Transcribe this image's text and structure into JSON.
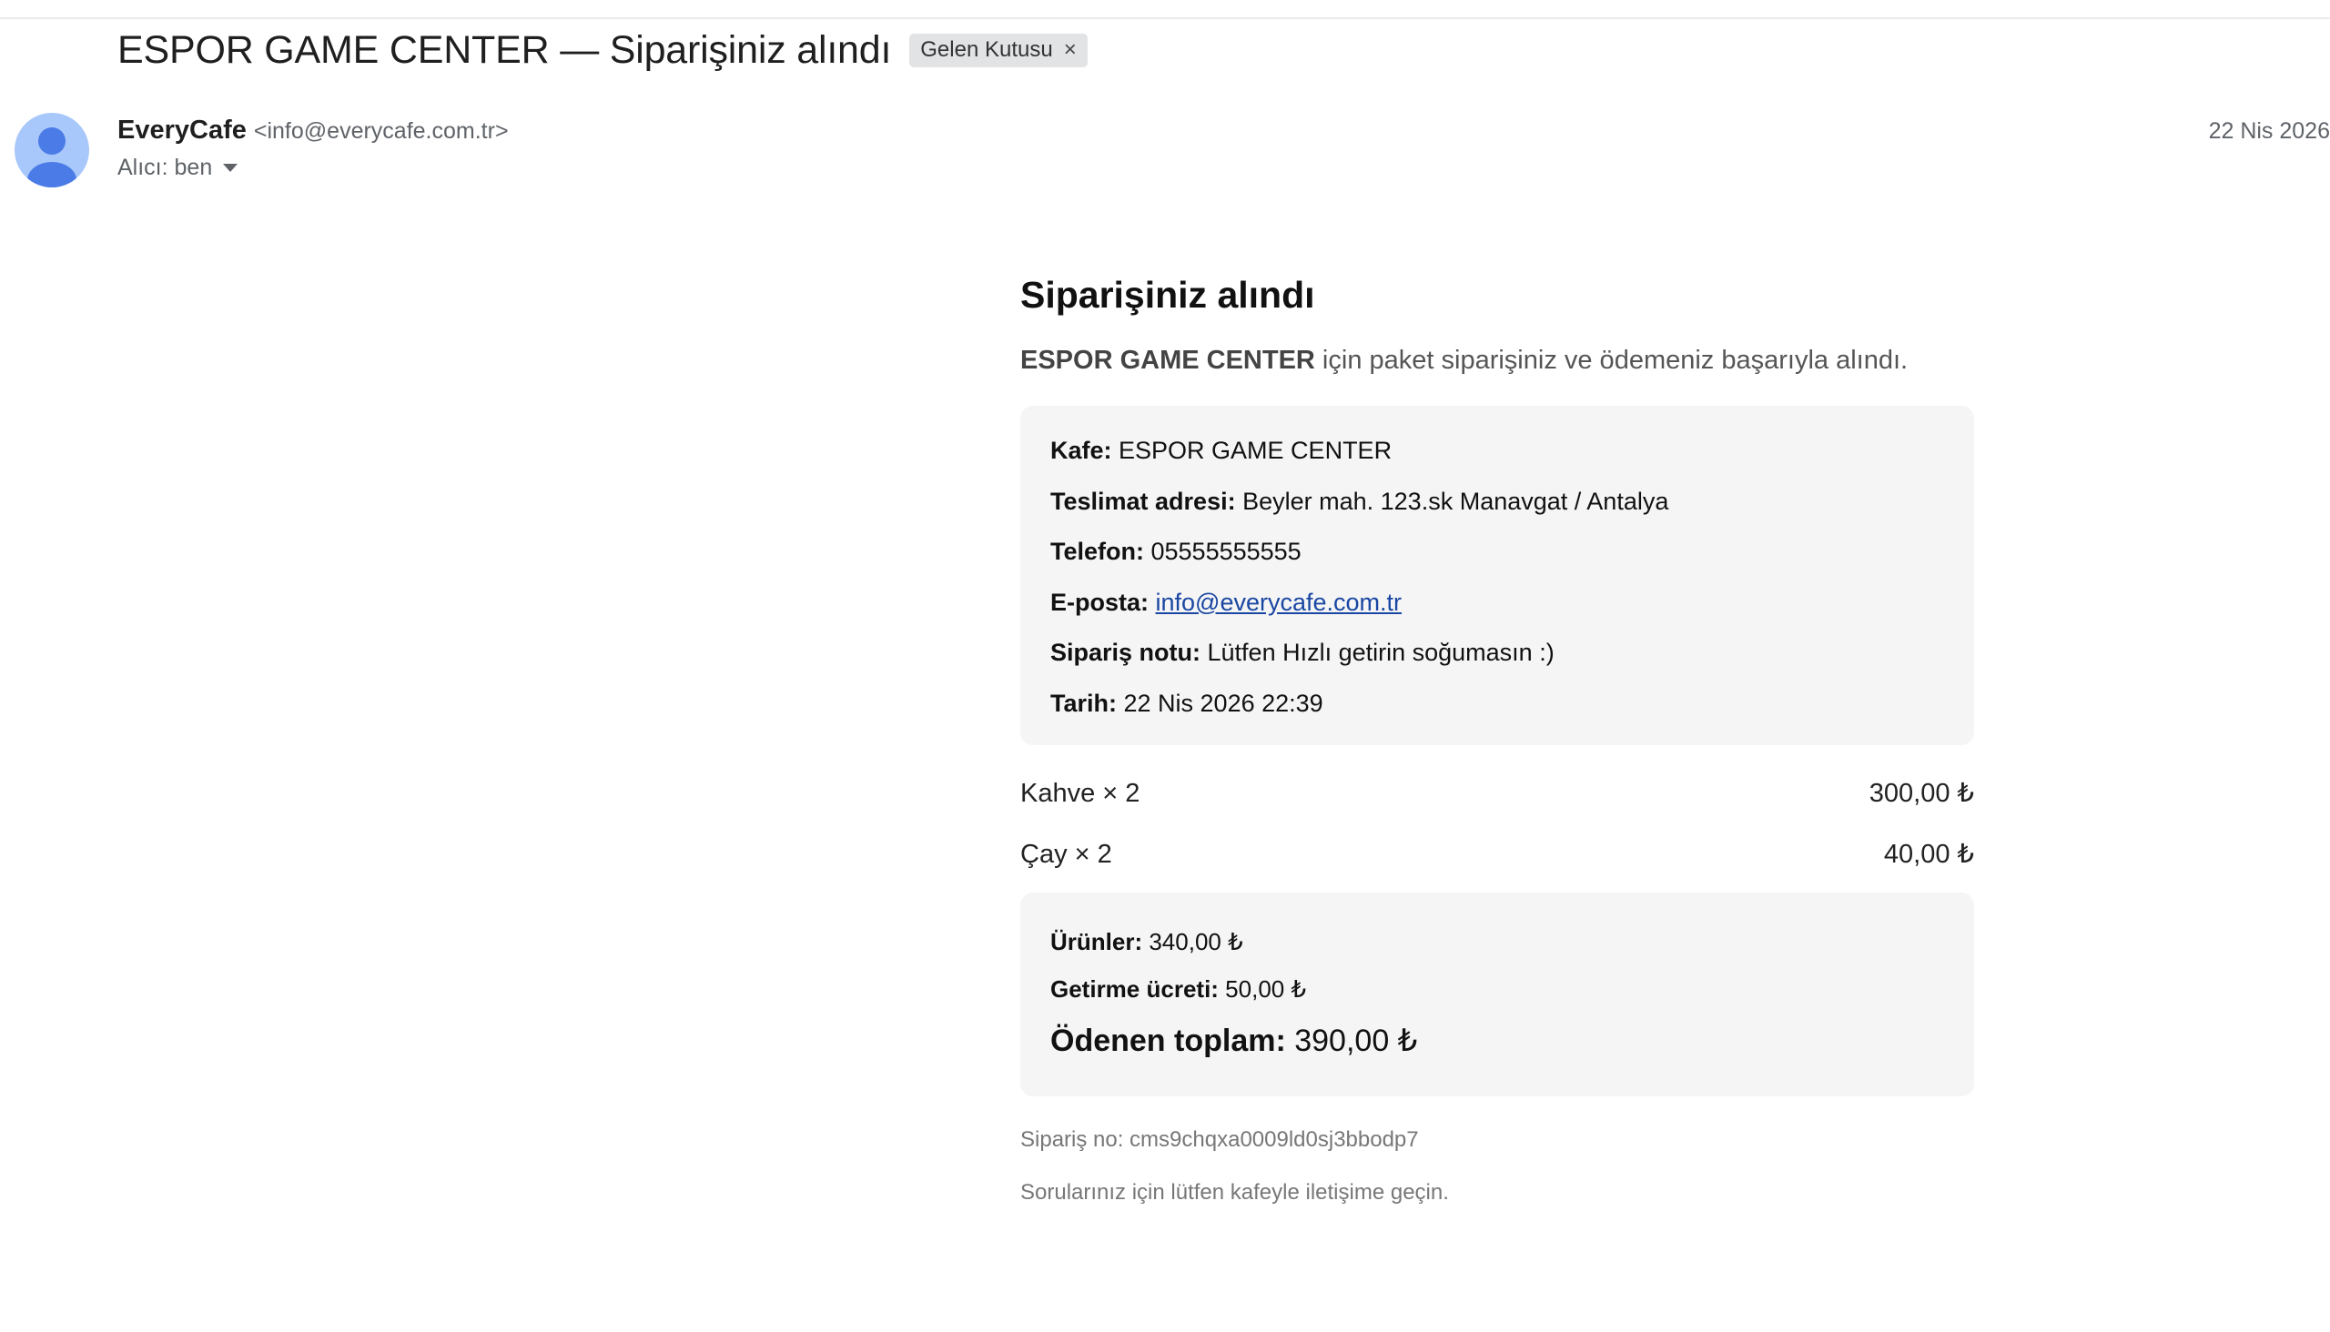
{
  "email": {
    "subject": "ESPOR GAME CENTER — Siparişiniz alındı",
    "label": "Gelen Kutusu",
    "label_remove_icon": "×",
    "sender_name": "EveryCafe",
    "sender_email": "<info@everycafe.com.tr>",
    "recipient": "Alıcı: ben",
    "date": "22 Nis 2026"
  },
  "body": {
    "heading": "Siparişiniz alındı",
    "intro_cafe": "ESPOR GAME CENTER",
    "intro_rest": " için paket siparişiniz ve ödemeniz başarıyla alındı.",
    "info": {
      "cafe_label": "Kafe:",
      "cafe_value": " ESPOR GAME CENTER",
      "address_label": "Teslimat adresi:",
      "address_value": " Beyler mah. 123.sk Manavgat / Antalya",
      "phone_label": "Telefon:",
      "phone_value": " 05555555555",
      "email_label": "E-posta:",
      "email_value": "info@everycafe.com.tr",
      "note_label": "Sipariş notu:",
      "note_value": " Lütfen Hızlı getirin soğumasın :)",
      "date_label": "Tarih:",
      "date_value": " 22 Nis 2026 22:39"
    },
    "items": [
      {
        "name": "Kahve × 2",
        "price": "300,00 ₺"
      },
      {
        "name": "Çay × 2",
        "price": "40,00 ₺"
      }
    ],
    "totals": {
      "products_label": "Ürünler:",
      "products_value": " 340,00 ₺",
      "delivery_label": "Getirme ücreti:",
      "delivery_value": " 50,00 ₺",
      "paid_label": "Ödenen toplam:",
      "paid_value": " 390,00 ₺"
    },
    "order_no": "Sipariş no: cms9chqxa0009ld0sj3bbodp7",
    "footer": "Sorularınız için lütfen kafeyle iletişime geçin."
  },
  "colors": {
    "link": "#1a47a3",
    "avatar_bg": "#a8c7fa",
    "avatar_fg": "#4b7be6"
  }
}
